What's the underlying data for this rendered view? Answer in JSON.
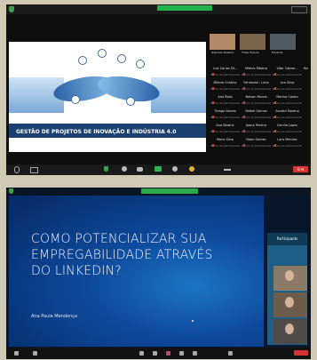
{
  "screen1": {
    "slide": {
      "title": "GESTÃO DE PROJETOS DE INOVAÇÃO E INDÚSTRIA 4.0"
    },
    "videos": [
      {
        "label": "Gabriela Teixeira"
      },
      {
        "label": "Thais Helena"
      },
      {
        "label": "Eduardo"
      }
    ],
    "participants": [
      [
        "Luiz Carlos Sil...",
        "Milena Ribeiro",
        "Vitor Cabral...",
        "Rafael Souza"
      ],
      [
        "Milena Cristina",
        "Fernanda - Lima",
        "Leo Silva",
        "Bruna Alves"
      ],
      [
        "Ana Rosa",
        "Nelson Moura",
        "Marina Castro",
        "Brena Santos"
      ],
      [
        "Thiago Nalves",
        "Rafael Gomes",
        "Sandra Moreno",
        "CARLOS SOUZA"
      ],
      [
        "Ana Beatriz",
        "Joana Pereira",
        "Camila Lopes",
        "Renato Alves"
      ],
      [
        "Mario Silva",
        "Fabio Gomes",
        "Lara Mendes",
        "Paulo Rocha"
      ]
    ],
    "participant_sub": "Nome do participante",
    "end_label": "End"
  },
  "screen2": {
    "slide": {
      "title": "COMO POTENCIALIZAR SUA EMPREGABILIDADE ATRAVÉS DO LINKEDIN?",
      "author": "Ana Paula Mendonça"
    },
    "panel_header": "Participants"
  },
  "colors": {
    "background": "#cfc9b6",
    "zoom_green": "#23b24c",
    "end_red": "#d73434",
    "slide2_blue": "#0e4a9c"
  }
}
